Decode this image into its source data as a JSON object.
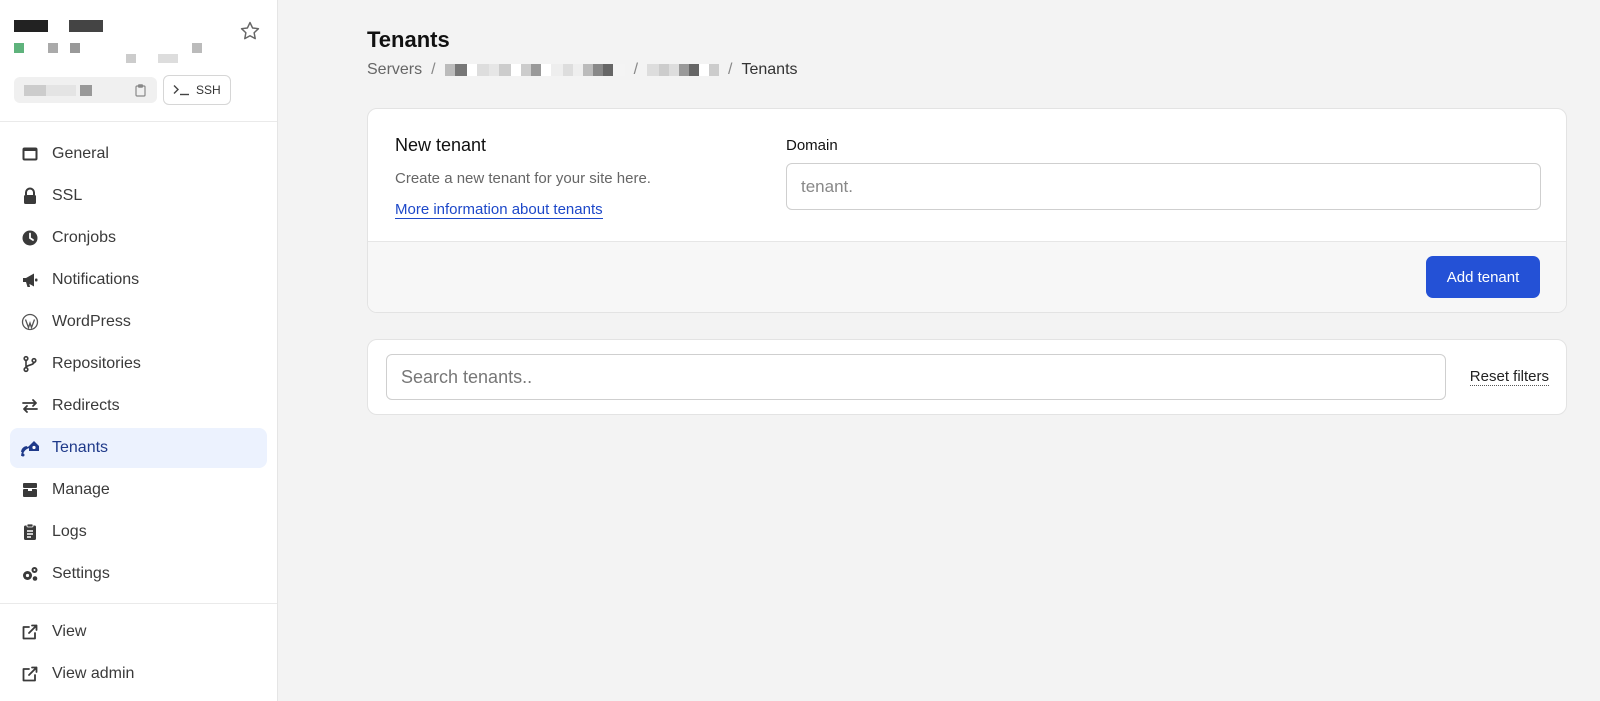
{
  "ssh_label": "SSH",
  "nav": {
    "general": "General",
    "ssl": "SSL",
    "cronjobs": "Cronjobs",
    "notifications": "Notifications",
    "wordpress": "WordPress",
    "repositories": "Repositories",
    "redirects": "Redirects",
    "tenants": "Tenants",
    "manage": "Manage",
    "logs": "Logs",
    "settings": "Settings",
    "view": "View",
    "view_admin": "View admin"
  },
  "page": {
    "title": "Tenants",
    "breadcrumb_root": "Servers",
    "breadcrumb_current": "Tenants"
  },
  "new_tenant": {
    "title": "New tenant",
    "description": "Create a new tenant for your site here.",
    "link": "More information about tenants",
    "domain_label": "Domain",
    "domain_placeholder": "tenant.",
    "add_button": "Add tenant"
  },
  "search": {
    "placeholder": "Search tenants..",
    "reset": "Reset filters"
  },
  "colors": {
    "accent": "#2451d6",
    "active_nav_bg": "#ecf2fe",
    "link": "#1d48c9"
  }
}
